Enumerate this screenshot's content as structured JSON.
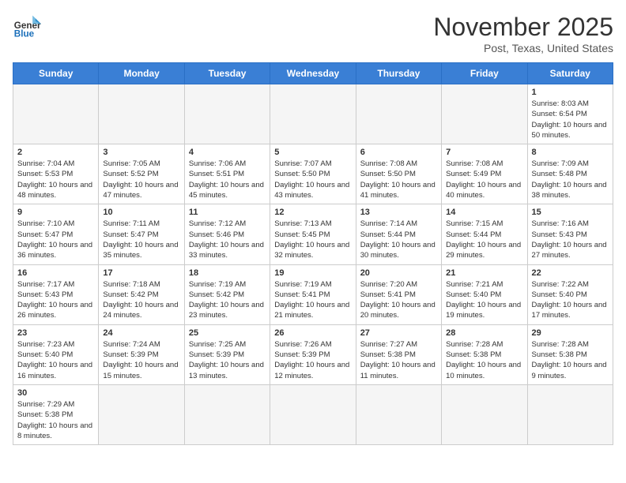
{
  "header": {
    "logo_general": "General",
    "logo_blue": "Blue",
    "month_title": "November 2025",
    "location": "Post, Texas, United States"
  },
  "weekdays": [
    "Sunday",
    "Monday",
    "Tuesday",
    "Wednesday",
    "Thursday",
    "Friday",
    "Saturday"
  ],
  "weeks": [
    [
      {
        "day": "",
        "empty": true
      },
      {
        "day": "",
        "empty": true
      },
      {
        "day": "",
        "empty": true
      },
      {
        "day": "",
        "empty": true
      },
      {
        "day": "",
        "empty": true
      },
      {
        "day": "",
        "empty": true
      },
      {
        "day": "1",
        "sunrise": "8:03 AM",
        "sunset": "6:54 PM",
        "daylight": "10 hours and 50 minutes."
      }
    ],
    [
      {
        "day": "2",
        "sunrise": "7:04 AM",
        "sunset": "5:53 PM",
        "daylight": "10 hours and 48 minutes."
      },
      {
        "day": "3",
        "sunrise": "7:05 AM",
        "sunset": "5:52 PM",
        "daylight": "10 hours and 47 minutes."
      },
      {
        "day": "4",
        "sunrise": "7:06 AM",
        "sunset": "5:51 PM",
        "daylight": "10 hours and 45 minutes."
      },
      {
        "day": "5",
        "sunrise": "7:07 AM",
        "sunset": "5:50 PM",
        "daylight": "10 hours and 43 minutes."
      },
      {
        "day": "6",
        "sunrise": "7:08 AM",
        "sunset": "5:50 PM",
        "daylight": "10 hours and 41 minutes."
      },
      {
        "day": "7",
        "sunrise": "7:08 AM",
        "sunset": "5:49 PM",
        "daylight": "10 hours and 40 minutes."
      },
      {
        "day": "8",
        "sunrise": "7:09 AM",
        "sunset": "5:48 PM",
        "daylight": "10 hours and 38 minutes."
      }
    ],
    [
      {
        "day": "9",
        "sunrise": "7:10 AM",
        "sunset": "5:47 PM",
        "daylight": "10 hours and 36 minutes."
      },
      {
        "day": "10",
        "sunrise": "7:11 AM",
        "sunset": "5:47 PM",
        "daylight": "10 hours and 35 minutes."
      },
      {
        "day": "11",
        "sunrise": "7:12 AM",
        "sunset": "5:46 PM",
        "daylight": "10 hours and 33 minutes."
      },
      {
        "day": "12",
        "sunrise": "7:13 AM",
        "sunset": "5:45 PM",
        "daylight": "10 hours and 32 minutes."
      },
      {
        "day": "13",
        "sunrise": "7:14 AM",
        "sunset": "5:44 PM",
        "daylight": "10 hours and 30 minutes."
      },
      {
        "day": "14",
        "sunrise": "7:15 AM",
        "sunset": "5:44 PM",
        "daylight": "10 hours and 29 minutes."
      },
      {
        "day": "15",
        "sunrise": "7:16 AM",
        "sunset": "5:43 PM",
        "daylight": "10 hours and 27 minutes."
      }
    ],
    [
      {
        "day": "16",
        "sunrise": "7:17 AM",
        "sunset": "5:43 PM",
        "daylight": "10 hours and 26 minutes."
      },
      {
        "day": "17",
        "sunrise": "7:18 AM",
        "sunset": "5:42 PM",
        "daylight": "10 hours and 24 minutes."
      },
      {
        "day": "18",
        "sunrise": "7:19 AM",
        "sunset": "5:42 PM",
        "daylight": "10 hours and 23 minutes."
      },
      {
        "day": "19",
        "sunrise": "7:19 AM",
        "sunset": "5:41 PM",
        "daylight": "10 hours and 21 minutes."
      },
      {
        "day": "20",
        "sunrise": "7:20 AM",
        "sunset": "5:41 PM",
        "daylight": "10 hours and 20 minutes."
      },
      {
        "day": "21",
        "sunrise": "7:21 AM",
        "sunset": "5:40 PM",
        "daylight": "10 hours and 19 minutes."
      },
      {
        "day": "22",
        "sunrise": "7:22 AM",
        "sunset": "5:40 PM",
        "daylight": "10 hours and 17 minutes."
      }
    ],
    [
      {
        "day": "23",
        "sunrise": "7:23 AM",
        "sunset": "5:40 PM",
        "daylight": "10 hours and 16 minutes."
      },
      {
        "day": "24",
        "sunrise": "7:24 AM",
        "sunset": "5:39 PM",
        "daylight": "10 hours and 15 minutes."
      },
      {
        "day": "25",
        "sunrise": "7:25 AM",
        "sunset": "5:39 PM",
        "daylight": "10 hours and 13 minutes."
      },
      {
        "day": "26",
        "sunrise": "7:26 AM",
        "sunset": "5:39 PM",
        "daylight": "10 hours and 12 minutes."
      },
      {
        "day": "27",
        "sunrise": "7:27 AM",
        "sunset": "5:38 PM",
        "daylight": "10 hours and 11 minutes."
      },
      {
        "day": "28",
        "sunrise": "7:28 AM",
        "sunset": "5:38 PM",
        "daylight": "10 hours and 10 minutes."
      },
      {
        "day": "29",
        "sunrise": "7:28 AM",
        "sunset": "5:38 PM",
        "daylight": "10 hours and 9 minutes."
      }
    ],
    [
      {
        "day": "30",
        "sunrise": "7:29 AM",
        "sunset": "5:38 PM",
        "daylight": "10 hours and 8 minutes."
      },
      {
        "day": "",
        "empty": true
      },
      {
        "day": "",
        "empty": true
      },
      {
        "day": "",
        "empty": true
      },
      {
        "day": "",
        "empty": true
      },
      {
        "day": "",
        "empty": true
      },
      {
        "day": "",
        "empty": true
      }
    ]
  ]
}
